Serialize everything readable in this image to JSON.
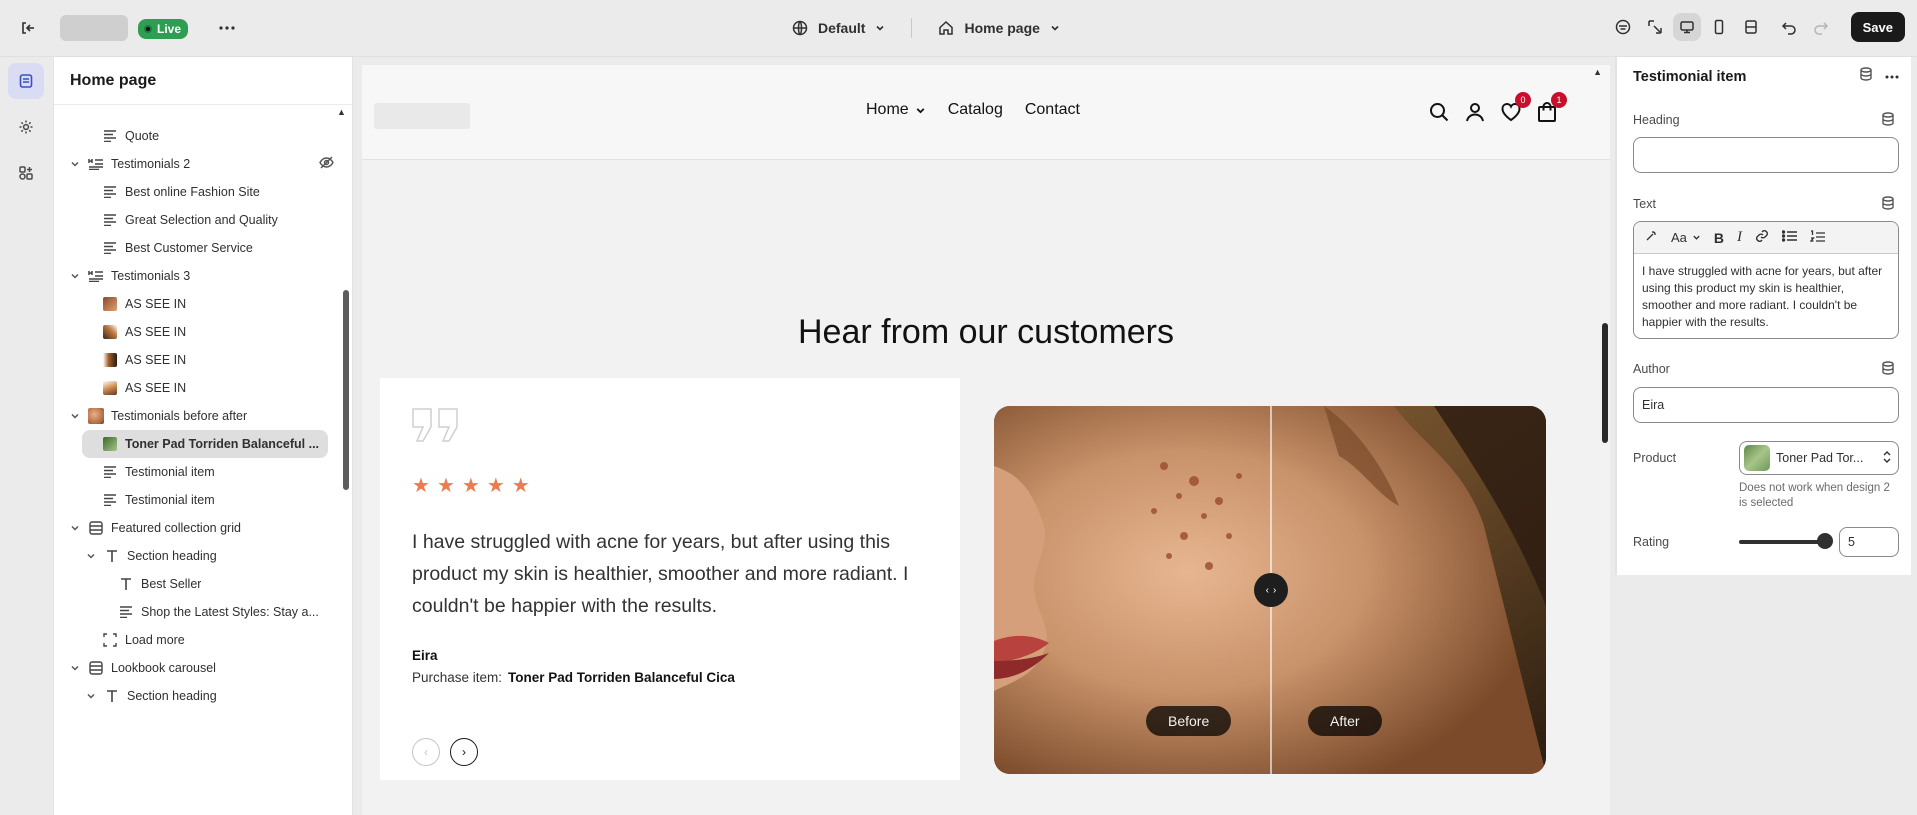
{
  "topbar": {
    "live_label": "Live",
    "theme_label": "Default",
    "page_label": "Home page",
    "save_label": "Save"
  },
  "sidebar": {
    "title": "Home page",
    "items": [
      {
        "label": "Quote"
      },
      {
        "label": "Testimonials 2"
      },
      {
        "label": "Best online Fashion Site"
      },
      {
        "label": "Great Selection and Quality"
      },
      {
        "label": "Best Customer Service"
      },
      {
        "label": "Testimonials 3"
      },
      {
        "label": "AS SEE IN"
      },
      {
        "label": "AS SEE IN"
      },
      {
        "label": "AS SEE IN"
      },
      {
        "label": "AS SEE IN"
      },
      {
        "label": "Testimonials before after"
      },
      {
        "label": "Toner Pad Torriden Balanceful ..."
      },
      {
        "label": "Testimonial item"
      },
      {
        "label": "Testimonial item"
      },
      {
        "label": "Featured collection grid"
      },
      {
        "label": "Section heading"
      },
      {
        "label": "Best Seller"
      },
      {
        "label": "Shop the Latest Styles: Stay a..."
      },
      {
        "label": "Load more"
      },
      {
        "label": "Lookbook carousel"
      },
      {
        "label": "Section heading"
      }
    ]
  },
  "store": {
    "nav": {
      "home": "Home",
      "catalog": "Catalog",
      "contact": "Contact"
    },
    "wishlist_count": "0",
    "cart_count": "1",
    "section_title": "Hear from our customers",
    "testimonial": {
      "rating": 5,
      "text": "I have struggled with acne for years, but after using this product my skin is healthier, smoother and more radiant. I couldn't be happier with the results.",
      "author": "Eira",
      "purchase_label": "Purchase item:",
      "purchase_product": "Toner Pad Torriden Balanceful Cica"
    },
    "before_label": "Before",
    "after_label": "After"
  },
  "settings": {
    "title": "Testimonial item",
    "heading_label": "Heading",
    "heading_value": "",
    "text_label": "Text",
    "text_value": "I have struggled with acne for years, but after using this product my skin is healthier, smoother and more radiant. I couldn't be happier with the results.",
    "font_button_label": "Aa",
    "author_label": "Author",
    "author_value": "Eira",
    "product_label": "Product",
    "product_value": "Toner Pad Tor...",
    "product_help": "Does not work when design 2 is selected",
    "rating_label": "Rating",
    "rating_value": "5"
  }
}
